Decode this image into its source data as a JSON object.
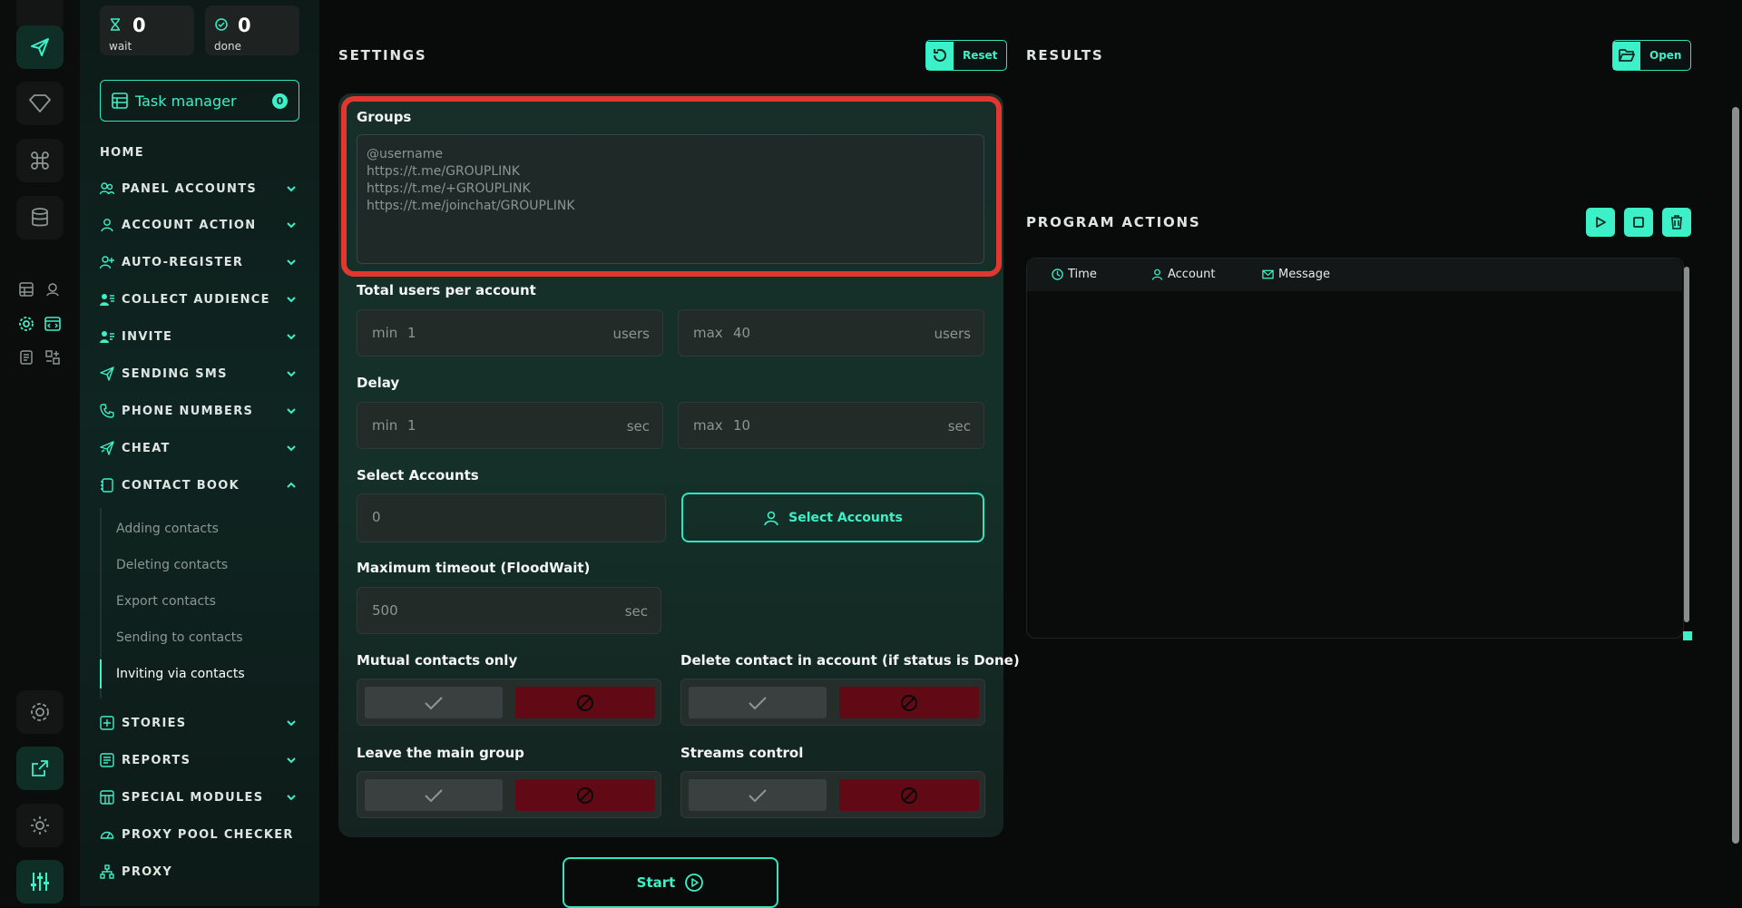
{
  "counters": {
    "wait": {
      "value": "0",
      "label": "wait",
      "icon": "hourglass-icon"
    },
    "done": {
      "value": "0",
      "label": "done",
      "icon": "check-circle-icon"
    }
  },
  "task_manager": {
    "label": "Task manager",
    "badge": "0"
  },
  "nav": {
    "home": "HOME",
    "items": [
      {
        "label": "PANEL ACCOUNTS",
        "icon": "users-icon",
        "expanded": false
      },
      {
        "label": "ACCOUNT ACTION",
        "icon": "user-icon",
        "expanded": false
      },
      {
        "label": "AUTO-REGISTER",
        "icon": "user-plus-icon",
        "expanded": false
      },
      {
        "label": "COLLECT AUDIENCE",
        "icon": "user-list-icon",
        "expanded": false
      },
      {
        "label": "INVITE",
        "icon": "user-invite-icon",
        "expanded": false
      },
      {
        "label": "SENDING SMS",
        "icon": "send-icon",
        "expanded": false
      },
      {
        "label": "PHONE NUMBERS",
        "icon": "phone-icon",
        "expanded": false
      },
      {
        "label": "CHEAT",
        "icon": "send-cheat-icon",
        "expanded": false
      },
      {
        "label": "CONTACT BOOK",
        "icon": "contact-book-icon",
        "expanded": true
      },
      {
        "label": "STORIES",
        "icon": "stories-icon",
        "expanded": false
      },
      {
        "label": "REPORTS",
        "icon": "reports-icon",
        "expanded": false
      },
      {
        "label": "SPECIAL MODULES",
        "icon": "modules-icon",
        "expanded": false
      },
      {
        "label": "PROXY POOL CHECKER",
        "icon": "gauge-icon",
        "expanded": false
      },
      {
        "label": "PROXY",
        "icon": "proxy-icon",
        "expanded": false
      }
    ],
    "contact_book_sub": [
      "Adding contacts",
      "Deleting contacts",
      "Export contacts",
      "Sending to contacts",
      "Inviting via contacts"
    ],
    "active_sub": "Inviting via contacts"
  },
  "settings": {
    "title": "SETTINGS",
    "reset_label": "Reset",
    "groups": {
      "label": "Groups",
      "placeholder": "@username\nhttps://t.me/GROUPLINK\nhttps://t.me/+GROUPLINK\nhttps://t.me/joinchat/GROUPLINK",
      "value": ""
    },
    "total_users": {
      "label": "Total users per account",
      "min_prefix": "min",
      "min": "1",
      "max_prefix": "max",
      "max": "40",
      "unit": "users"
    },
    "delay": {
      "label": "Delay",
      "min_prefix": "min",
      "min": "1",
      "max_prefix": "max",
      "max": "10",
      "unit": "sec"
    },
    "select_accounts": {
      "label": "Select Accounts",
      "value": "0",
      "button": "Select Accounts"
    },
    "max_timeout": {
      "label": "Maximum timeout (FloodWait)",
      "value": "500",
      "unit": "sec"
    },
    "mutual_contacts": {
      "label": "Mutual contacts only"
    },
    "delete_contact": {
      "label": "Delete contact in account (if status is Done)"
    },
    "leave_group": {
      "label": "Leave the main group"
    },
    "streams_control": {
      "label": "Streams control"
    },
    "start_label": "Start"
  },
  "results": {
    "title": "RESULTS",
    "open_label": "Open"
  },
  "program_actions": {
    "title": "PROGRAM ACTIONS",
    "columns": [
      "Time",
      "Account",
      "Message"
    ]
  },
  "colors": {
    "accent": "#3cf0c8",
    "danger": "#610915",
    "highlight": "#e2372f",
    "panel": "#172e29"
  }
}
